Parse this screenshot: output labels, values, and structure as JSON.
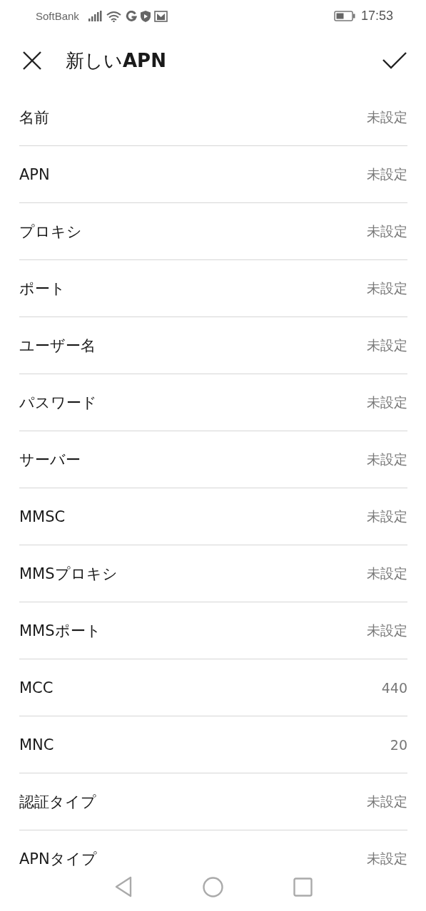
{
  "status_bar": {
    "carrier": "SoftBank",
    "time": "17:53"
  },
  "header": {
    "title": "新しい**APN**"
  },
  "fields": [
    {
      "label": "名前",
      "value": "未設定"
    },
    {
      "label": "APN",
      "value": "未設定"
    },
    {
      "label": "プロキシ",
      "value": "未設定"
    },
    {
      "label": "ポート",
      "value": "未設定"
    },
    {
      "label": "ユーザー名",
      "value": "未設定"
    },
    {
      "label": "パスワード",
      "value": "未設定"
    },
    {
      "label": "サーバー",
      "value": "未設定"
    },
    {
      "label": "MMSC",
      "value": "未設定"
    },
    {
      "label": "MMSプロキシ",
      "value": "未設定"
    },
    {
      "label": "MMSポート",
      "value": "未設定"
    },
    {
      "label": "MCC",
      "value": "440"
    },
    {
      "label": "MNC",
      "value": "20"
    },
    {
      "label": "認証タイプ",
      "value": "未設定"
    },
    {
      "label": "APNタイプ",
      "value": "未設定"
    }
  ]
}
